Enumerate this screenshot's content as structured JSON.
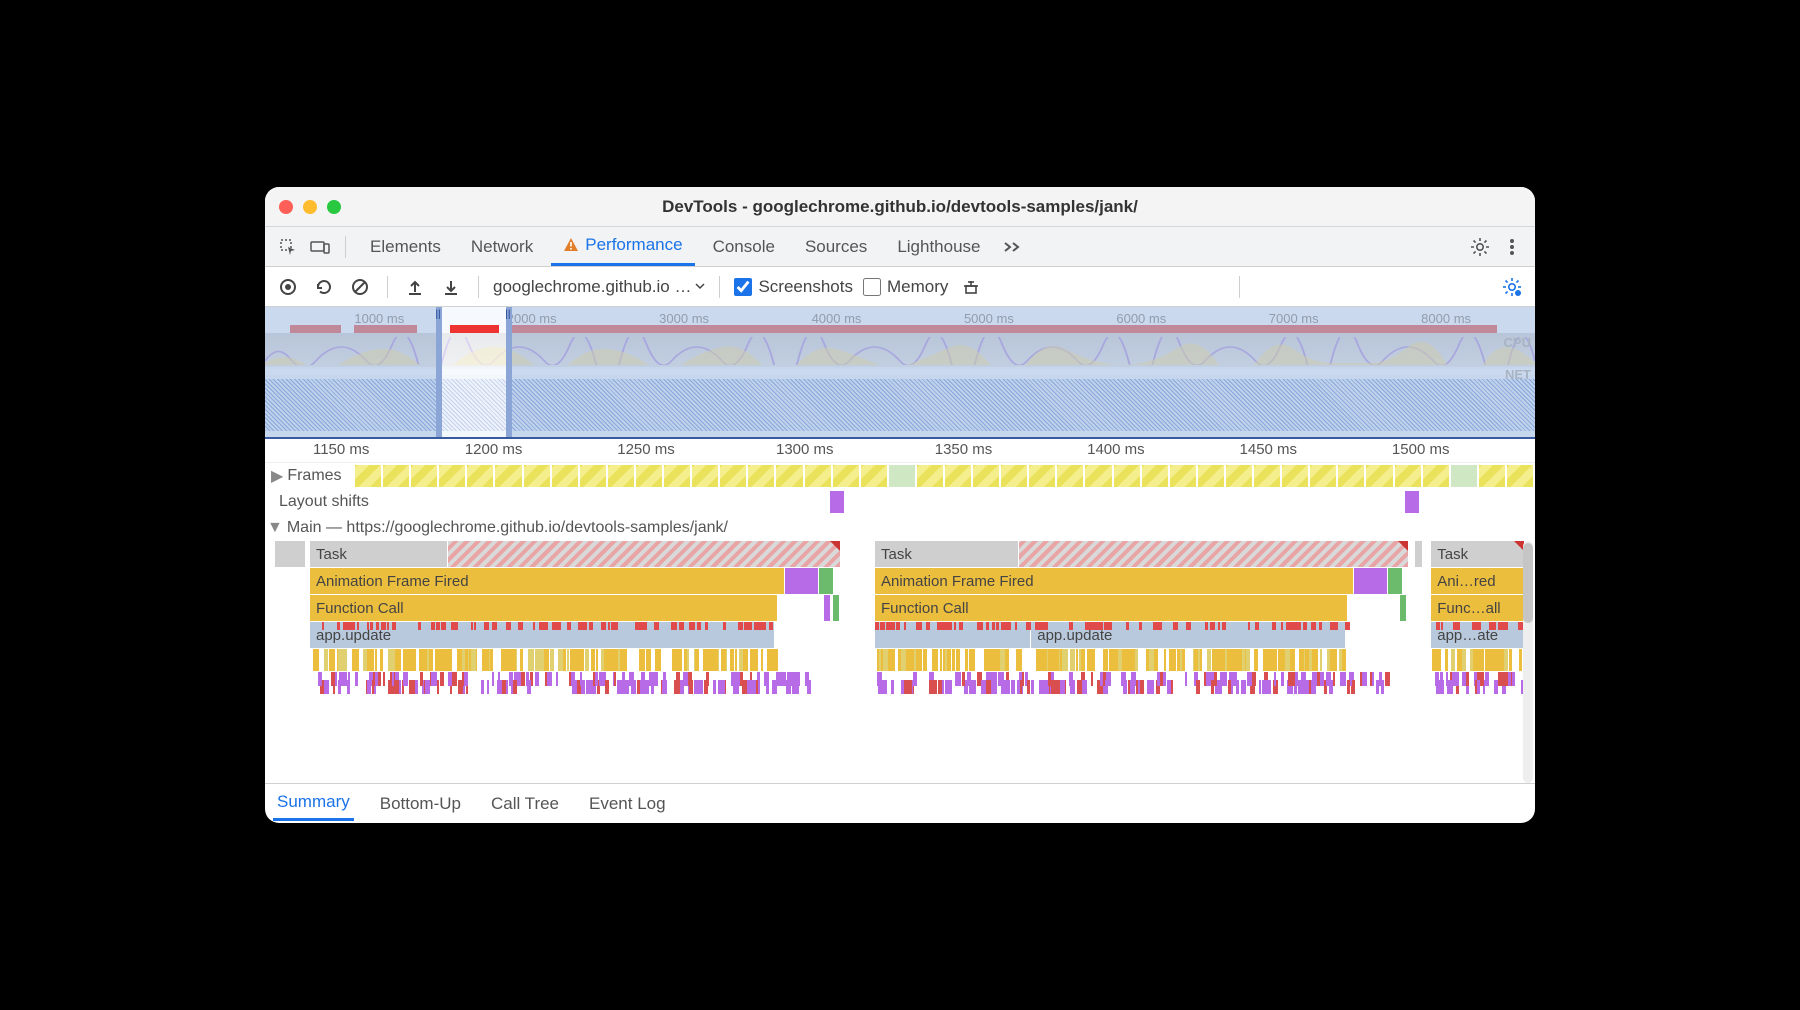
{
  "window": {
    "title": "DevTools - googlechrome.github.io/devtools-samples/jank/"
  },
  "panelTabs": {
    "elements": "Elements",
    "network": "Network",
    "performance": "Performance",
    "console": "Console",
    "sources": "Sources",
    "lighthouse": "Lighthouse"
  },
  "toolbar": {
    "dropdown": "googlechrome.github.io …",
    "screenshots": "Screenshots",
    "memory": "Memory"
  },
  "overview": {
    "ticks": [
      "1000 ms",
      "2000 ms",
      "3000 ms",
      "4000 ms",
      "5000 ms",
      "6000 ms",
      "7000 ms",
      "8000 ms"
    ],
    "cpuLabel": "CPU",
    "netLabel": "NET"
  },
  "detail": {
    "ticks": [
      "1150 ms",
      "1200 ms",
      "1250 ms",
      "1300 ms",
      "1350 ms",
      "1400 ms",
      "1450 ms",
      "1500 ms"
    ],
    "framesLabel": "Frames",
    "layoutShiftsLabel": "Layout shifts",
    "mainLabel": "Main — https://googlechrome.github.io/devtools-samples/jank/",
    "task": "Task",
    "aff": "Animation Frame Fired",
    "fcall": "Function Call",
    "appupdate": "app.update",
    "affShort": "Ani…red",
    "fcallShort": "Func…all",
    "appShort": "app…ate"
  },
  "bottomTabs": {
    "summary": "Summary",
    "bottomUp": "Bottom-Up",
    "callTree": "Call Tree",
    "eventLog": "Event Log"
  }
}
